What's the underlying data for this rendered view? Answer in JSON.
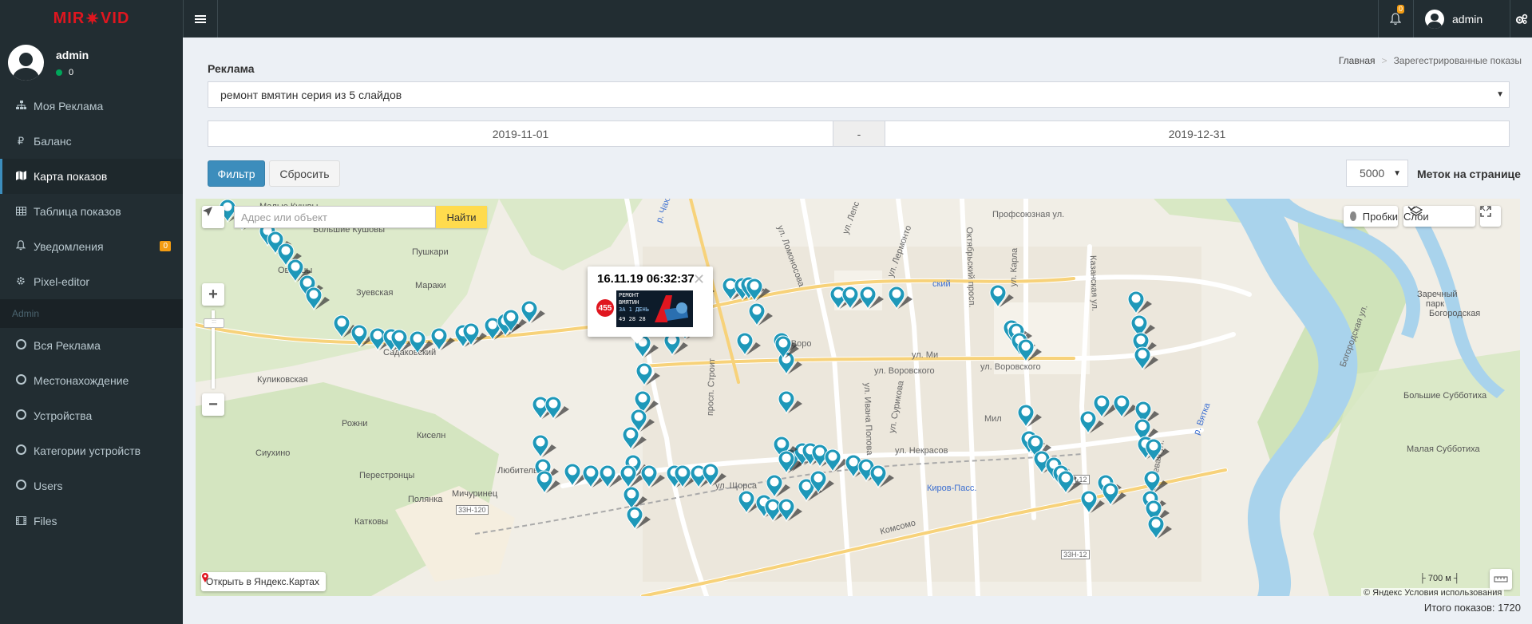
{
  "brand": {
    "left": "MIR",
    "star": "✷",
    "right": "VID"
  },
  "topbar": {
    "notifications_count": "0",
    "user": "admin"
  },
  "sidebar": {
    "user_name": "admin",
    "user_status": "0",
    "items": [
      {
        "label": "Моя Реклама",
        "icon": "sitemap-icon"
      },
      {
        "label": "Баланс",
        "icon": "ruble-icon"
      },
      {
        "label": "Карта показов",
        "icon": "map-icon"
      },
      {
        "label": "Таблица показов",
        "icon": "table-icon"
      },
      {
        "label": "Уведомления",
        "icon": "bell-icon",
        "badge": "0"
      },
      {
        "label": "Pixel-editor",
        "icon": "gear-icon"
      }
    ],
    "admin_header": "Admin",
    "admin_items": [
      {
        "label": "Вся Реклама"
      },
      {
        "label": "Местонахождение"
      },
      {
        "label": "Устройства"
      },
      {
        "label": "Категории устройств"
      },
      {
        "label": "Users"
      },
      {
        "label": "Files",
        "icon": "film-icon"
      }
    ]
  },
  "page": {
    "ad_label": "Реклама",
    "breadcrumb": {
      "home": "Главная",
      "separator": ">",
      "current": "Зарегестрированные показы"
    },
    "ad_select_value": "ремонт вмятин серия из 5 слайдов",
    "date_from": "2019-11-01",
    "date_separator": "-",
    "date_to": "2019-12-31",
    "filter_button": "Фильтр",
    "reset_button": "Сбросить",
    "per_page_value": "5000",
    "per_page_label": "Меток на странице",
    "total": "Итого показов: 1720"
  },
  "map": {
    "search_placeholder": "Адрес или объект",
    "find_button": "Найти",
    "traffic_button": "Пробки",
    "layers_button": "Слои",
    "open_in_yandex": "Открыть в Яндекс.Картах",
    "scale": "700 м",
    "copyright_prefix": "© Яндекс",
    "copyright_link": "Условия использования",
    "balloon": {
      "title": "16.11.19 06:32:37",
      "number": "455",
      "preview_lines": [
        "РЕМОНТ",
        "ВМЯТИН",
        "ЗА 1 ДЕНЬ",
        "49 28 28"
      ]
    },
    "places": [
      "Малые Кушвы",
      "Большие Кушовы",
      "Пушкари",
      "Овершы",
      "Зуевская",
      "Мараки",
      "Садаковский",
      "Куликовская",
      "Рожни",
      "Киселн",
      "Сиухино",
      "Перестронцы",
      "Любитель",
      "Мичуринец",
      "Полянка",
      "Катковы",
      "Заречный парк",
      "Богородская",
      "Большие Субботиха",
      "Малая Субботиха",
      "Киров-Пасс.",
      "ский"
    ],
    "roads": [
      "ул. Ломоносова",
      "ул. Лепс",
      "ул. Лермонто",
      "Профсоюзная ул.",
      "Октябрьский просп.",
      "ул. Карла",
      "Казанская ул.",
      "Богородская ул.",
      "ул. Воровского",
      "ул. Воровского",
      "ул. Ивана Попова",
      "ул. Сурикова",
      "ул. Некрасов",
      "ул. Щорса",
      "Комсомо",
      "р. Вятка",
      "р. Чахл",
      "просп. Строит",
      "Ключевая ул.",
      "ул. Ми",
      "Мил",
      "33Н-120",
      "33Н-12",
      "33Н-12",
      "ул. Воро"
    ]
  }
}
